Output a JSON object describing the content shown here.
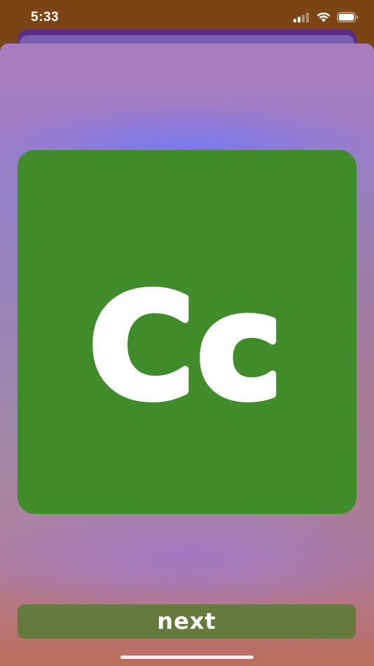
{
  "status_bar": {
    "time": "5:33",
    "signal_icon": "cellular-signal-icon",
    "wifi_icon": "wifi-icon",
    "battery_icon": "battery-icon"
  },
  "card": {
    "letter_text": "Cc",
    "background_color": "#418c2a",
    "text_color": "#ffffff"
  },
  "next_button": {
    "label": "next",
    "background_color": "#677a3e"
  }
}
